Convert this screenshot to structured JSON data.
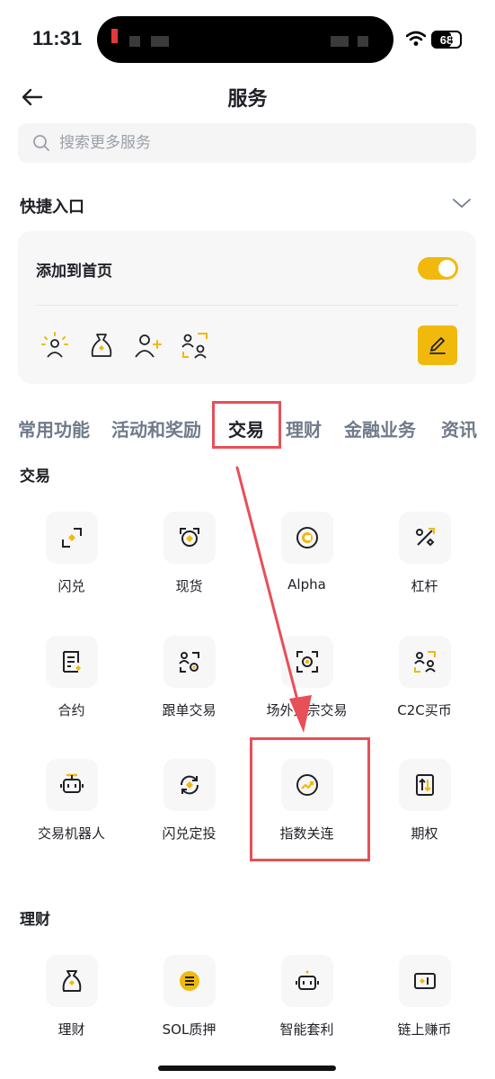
{
  "status_bar": {
    "time": "11:31",
    "battery": "68"
  },
  "header": {
    "title": "服务"
  },
  "search": {
    "placeholder": "搜索更多服务"
  },
  "quick_entry": {
    "title": "快捷入口",
    "add_to_home_label": "添加到首页",
    "toggle_on": true,
    "icons": [
      "sun-person-icon",
      "money-bag-icon",
      "add-user-icon",
      "person-scan-icon"
    ]
  },
  "tabs": [
    {
      "label": "常用功能",
      "active": false
    },
    {
      "label": "活动和奖励",
      "active": false
    },
    {
      "label": "交易",
      "active": true
    },
    {
      "label": "理财",
      "active": false
    },
    {
      "label": "金融业务",
      "active": false
    },
    {
      "label": "资讯",
      "active": false
    }
  ],
  "sections": [
    {
      "title": "交易",
      "items": [
        {
          "label": "闪兑",
          "icon": "convert-icon"
        },
        {
          "label": "现货",
          "icon": "spot-icon"
        },
        {
          "label": "Alpha",
          "icon": "alpha-icon"
        },
        {
          "label": "杠杆",
          "icon": "margin-icon"
        },
        {
          "label": "合约",
          "icon": "futures-icon"
        },
        {
          "label": "跟单交易",
          "icon": "copy-trading-icon"
        },
        {
          "label": "场外大宗交易",
          "icon": "otc-icon"
        },
        {
          "label": "C2C买币",
          "icon": "c2c-icon"
        },
        {
          "label": "交易机器人",
          "icon": "robot-icon"
        },
        {
          "label": "闪兑定投",
          "icon": "recurring-icon"
        },
        {
          "label": "指数关连",
          "icon": "index-link-icon"
        },
        {
          "label": "期权",
          "icon": "options-icon"
        }
      ]
    },
    {
      "title": "理财",
      "items": [
        {
          "label": "理财",
          "icon": "earn-icon"
        },
        {
          "label": "SOL质押",
          "icon": "sol-staking-icon"
        },
        {
          "label": "智能套利",
          "icon": "smart-arbitrage-icon"
        },
        {
          "label": "链上赚币",
          "icon": "onchain-earn-icon"
        }
      ]
    }
  ],
  "colors": {
    "accent": "#F0B90B",
    "highlight": "#E84F57",
    "text": "#1E2026",
    "muted": "#707A8A"
  }
}
